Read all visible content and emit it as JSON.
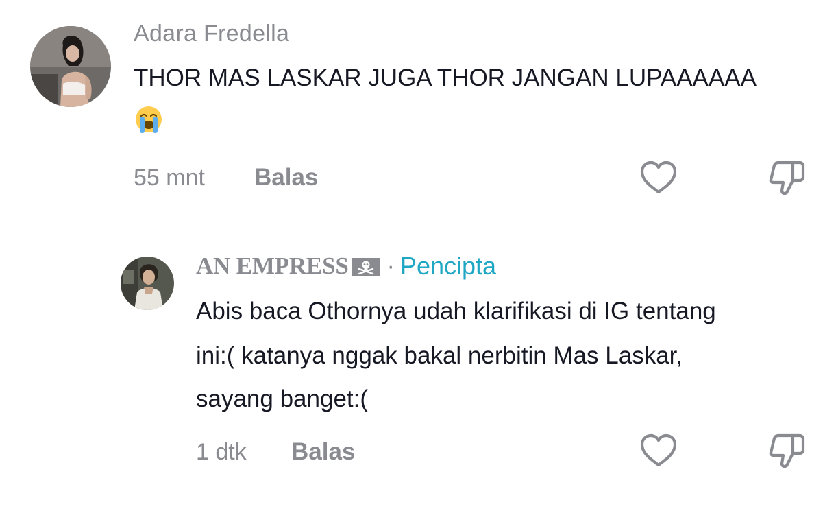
{
  "comment": {
    "username": "Adara Fredella",
    "text": "THOR MAS LASKAR JUGA THOR JANGAN LUPAAAAAA",
    "emoji": "loudly-crying-face",
    "time": "55 mnt",
    "reply_label": "Balas",
    "avatar_icon": "avatar-photo-woman",
    "like_icon": "heart-outline-icon",
    "dislike_icon": "thumbs-down-outline-icon"
  },
  "reply": {
    "username": "AN EMPRESS",
    "name_badge_icon": "pirate-flag-icon",
    "separator": "·",
    "creator_label": "Pencipta",
    "text_lines": [
      "Abis baca Othornya udah klarifikasi di IG tentang",
      "ini:( katanya nggak bakal nerbitin Mas Laskar,",
      "sayang banget:("
    ],
    "time": "1 dtk",
    "reply_label": "Balas",
    "avatar_icon": "avatar-photo-man",
    "like_icon": "heart-outline-icon",
    "dislike_icon": "thumbs-down-outline-icon"
  },
  "colors": {
    "muted_text": "#8a8b91",
    "body_text": "#161823",
    "creator_accent": "#20a7c4",
    "background": "#ffffff"
  }
}
